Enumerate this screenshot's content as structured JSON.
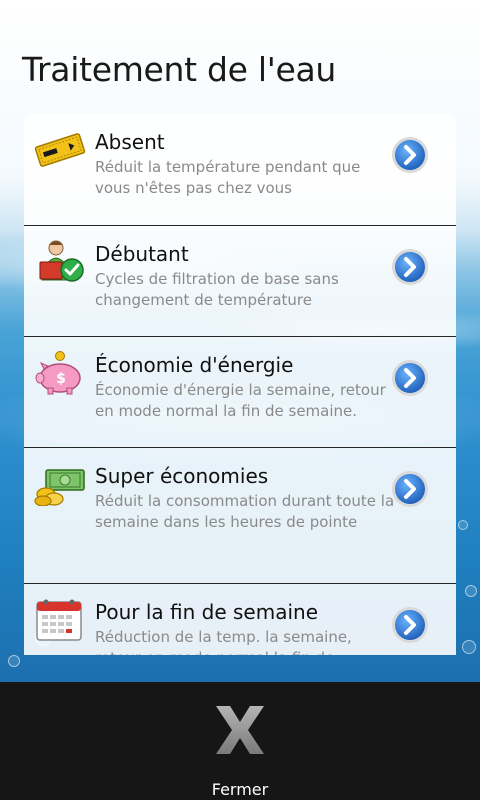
{
  "page": {
    "title": "Traitement de l'eau"
  },
  "items": [
    {
      "title": "Absent",
      "description": "Réduit la température pendant que vous n'êtes pas chez vous",
      "icon": "ticket-icon"
    },
    {
      "title": "Débutant",
      "description": "Cycles de filtration de base sans changement de température",
      "icon": "beginner-user-check-icon"
    },
    {
      "title": "Économie d'énergie",
      "description": "Économie d'énergie la semaine, retour en mode normal la fin de semaine.",
      "icon": "piggy-bank-icon"
    },
    {
      "title": "Super économies",
      "description": "Réduit la consommation durant toute la semaine dans les heures de pointe",
      "icon": "money-coins-icon"
    },
    {
      "title": "Pour la fin de semaine",
      "description": "Réduction de la temp. la semaine, retour en mode normal la fin de semaine.",
      "icon": "calendar-icon"
    }
  ],
  "footer": {
    "close_label": "Fermer"
  },
  "colors": {
    "accent_blue": "#2a73c9",
    "bottom_bar": "#161616",
    "water": "#2f91cf"
  }
}
